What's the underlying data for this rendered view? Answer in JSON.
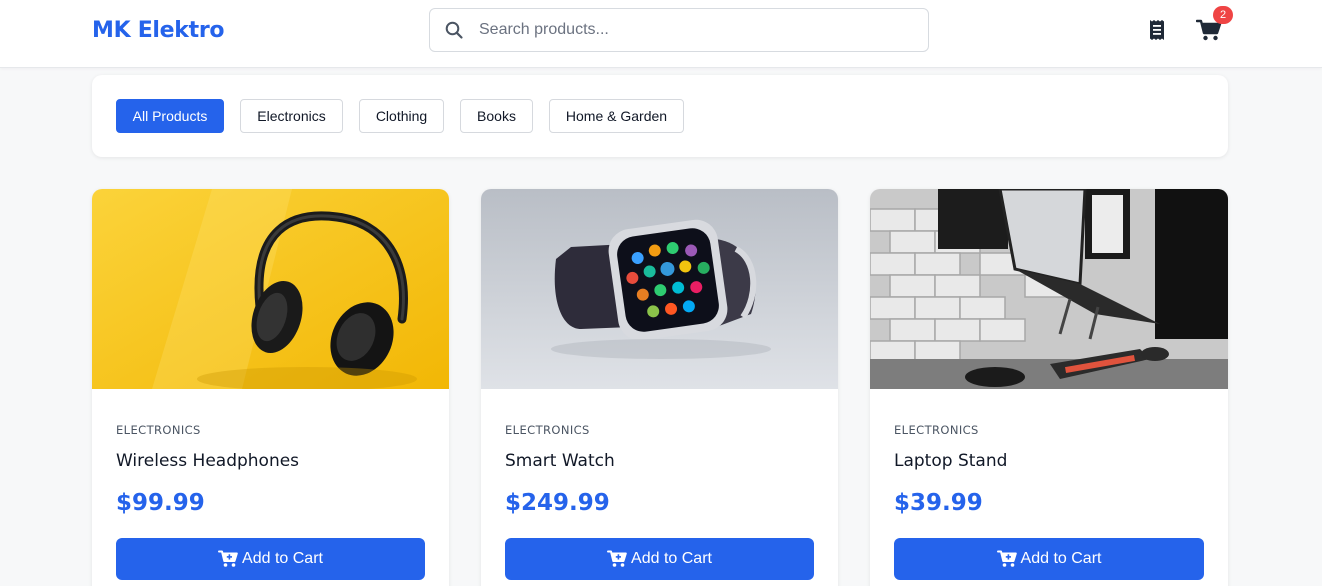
{
  "brand": "MK Elektro",
  "search": {
    "placeholder": "Search products...",
    "value": ""
  },
  "header": {
    "orders_icon": "receipt-icon",
    "cart_icon": "shopping-cart-icon",
    "cart_count": "2",
    "badge_color": "#ef4444"
  },
  "filters": [
    {
      "label": "All Products",
      "active": true
    },
    {
      "label": "Electronics",
      "active": false
    },
    {
      "label": "Clothing",
      "active": false
    },
    {
      "label": "Books",
      "active": false
    },
    {
      "label": "Home & Garden",
      "active": false
    }
  ],
  "products": [
    {
      "category": "ELECTRONICS",
      "name": "Wireless Headphones",
      "price": "$99.99",
      "button": "Add to Cart",
      "image": "headphones on yellow background"
    },
    {
      "category": "ELECTRONICS",
      "name": "Smart Watch",
      "price": "$249.99",
      "button": "Add to Cart",
      "image": "smart watch on grey background"
    },
    {
      "category": "ELECTRONICS",
      "name": "Laptop Stand",
      "price": "$39.99",
      "button": "Add to Cart",
      "image": "laptop on stand at desk"
    }
  ],
  "colors": {
    "accent": "#2563eb",
    "background": "#f7f8f9",
    "card": "#ffffff"
  }
}
